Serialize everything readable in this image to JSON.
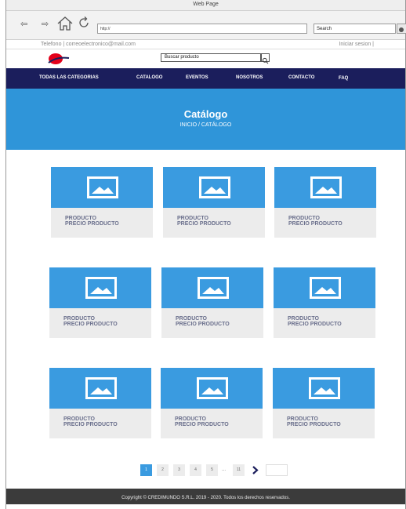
{
  "browser": {
    "window_title": "Web Page",
    "url": "http://",
    "search_placeholder": "Search"
  },
  "topbar": {
    "contact": "Telefono | correoelectronico@mail.com",
    "login": "Iniciar sesion |"
  },
  "header": {
    "logo_text": "CREDIMUNDO",
    "search_placeholder": "Buscar producto",
    "brand_red": "#e3001b"
  },
  "nav": {
    "items": [
      {
        "label": "TODAS LAS CATEGORIAS"
      },
      {
        "label": "CATALOGO"
      },
      {
        "label": "EVENTOS"
      },
      {
        "label": "NOSOTROS"
      },
      {
        "label": "CONTACTO"
      },
      {
        "label": "FAQ"
      }
    ],
    "background": "#1b1e5c"
  },
  "hero": {
    "title": "Catálogo",
    "breadcrumb": "INICIO / CATÁLOGO",
    "background": "#2f95d9"
  },
  "products": [
    {
      "name": "PRODUCTO",
      "price": "PRECIO PRODUCTO"
    },
    {
      "name": "PRODUCTO",
      "price": "PRECIO PRODUCTO"
    },
    {
      "name": "PRODUCTO",
      "price": "PRECIO PRODUCTO"
    },
    {
      "name": "PRODUCTO",
      "price": "PRECIO PRODUCTO"
    },
    {
      "name": "PRODUCTO",
      "price": "PRECIO PRODUCTO"
    },
    {
      "name": "PRODUCTO",
      "price": "PRECIO PRODUCTO"
    },
    {
      "name": "PRODUCTO",
      "price": "PRECIO PRODUCTO"
    },
    {
      "name": "PRODUCTO",
      "price": "PRECIO PRODUCTO"
    },
    {
      "name": "PRODUCTO",
      "price": "PRECIO PRODUCTO"
    }
  ],
  "pagination": {
    "pages": [
      "1",
      "2",
      "3",
      "4",
      "5"
    ],
    "ellipsis": "...",
    "last": "11",
    "current": "1"
  },
  "footer": {
    "copyright": "Copyright © CREDIMUNDO S.R.L. 2019 - 2020. Todos los derechos reservados."
  }
}
